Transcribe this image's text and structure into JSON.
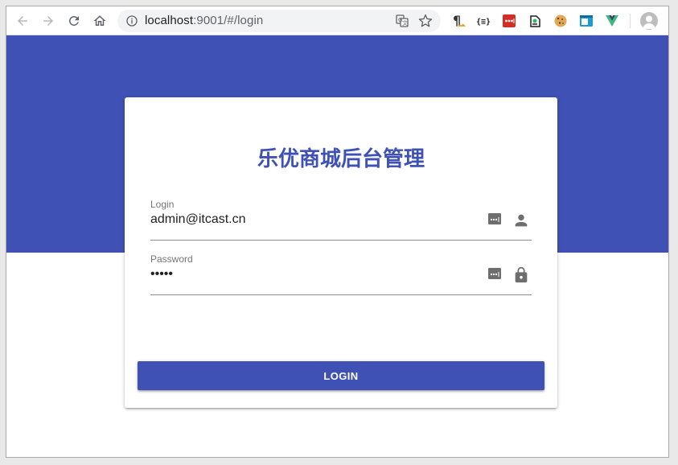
{
  "browser": {
    "url_host": "localhost",
    "url_path": ":9001/#/login",
    "icons": {
      "back": "back-arrow-icon",
      "forward": "forward-arrow-icon",
      "reload": "reload-icon",
      "home": "home-icon",
      "info": "info-icon",
      "translate": "translate-icon",
      "bookmark": "star-icon",
      "profile": "profile-avatar-icon"
    },
    "extensions": [
      {
        "name": "formatting-marks-extension-icon",
        "glyph": "¶"
      },
      {
        "name": "json-viewer-extension-icon",
        "glyph": "{≡}"
      },
      {
        "name": "lastpass-extension-icon",
        "glyph": "•••"
      },
      {
        "name": "evernote-extension-icon",
        "glyph": ""
      },
      {
        "name": "cookie-extension-icon",
        "glyph": ""
      },
      {
        "name": "window-resizer-extension-icon",
        "glyph": ""
      },
      {
        "name": "vue-devtools-extension-icon",
        "glyph": ""
      }
    ]
  },
  "login_page": {
    "title": "乐优商城后台管理",
    "login_field": {
      "label": "Login",
      "value": "admin@itcast.cn",
      "icon": "person-icon",
      "autofill_icon": "password-manager-key-icon"
    },
    "password_field": {
      "label": "Password",
      "value": "•••••",
      "icon": "lock-icon",
      "autofill_icon": "password-manager-key-icon"
    },
    "submit_label": "LOGIN"
  },
  "colors": {
    "primary": "#3f51b5",
    "browser_icon": "#5f6368",
    "field_icon": "#6e6e6e"
  }
}
